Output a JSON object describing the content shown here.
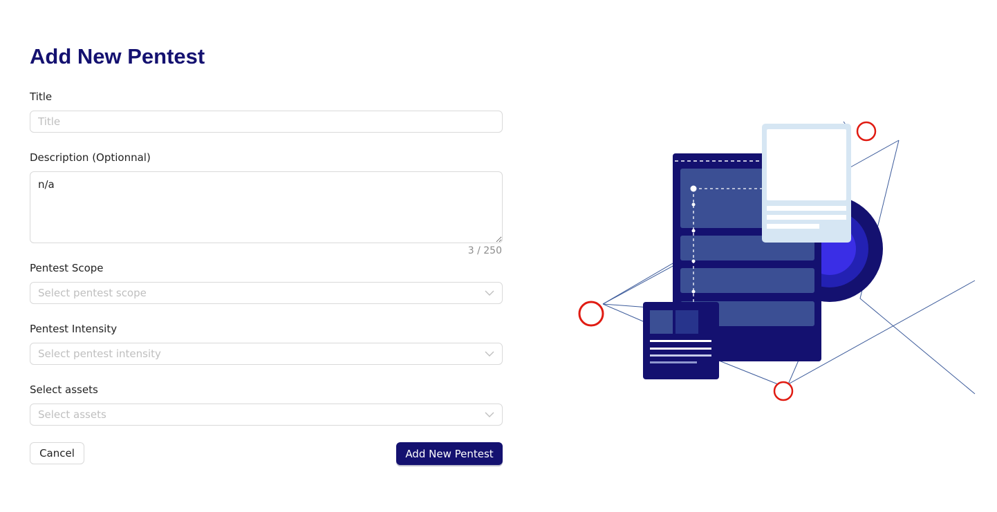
{
  "page": {
    "title": "Add New Pentest"
  },
  "form": {
    "title_field": {
      "label": "Title",
      "placeholder": "Title",
      "value": ""
    },
    "description_field": {
      "label": "Description (Optionnal)",
      "value": "n/a",
      "counter": "3 / 250"
    },
    "scope_field": {
      "label": "Pentest Scope",
      "placeholder": "Select pentest scope"
    },
    "intensity_field": {
      "label": "Pentest Intensity",
      "placeholder": "Select pentest intensity"
    },
    "assets_field": {
      "label": "Select assets",
      "placeholder": "Select assets"
    }
  },
  "actions": {
    "cancel_label": "Cancel",
    "submit_label": "Add New Pentest"
  },
  "icons": {
    "select_chevron": "chevron-down-icon"
  },
  "colors": {
    "primary": "#141170",
    "accent_red": "#e01b12",
    "accent_blue": "#3a2ee6",
    "panel_light": "#d6e6f3",
    "panel_mid": "#3b4f94"
  }
}
